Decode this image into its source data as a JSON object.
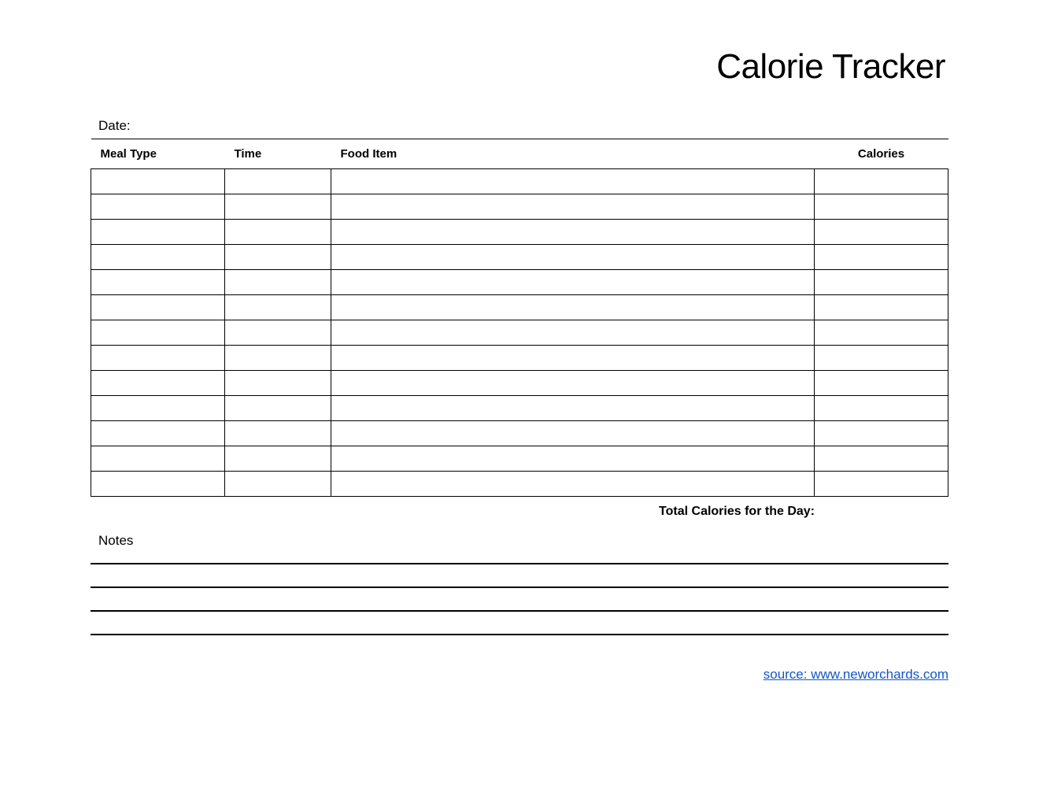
{
  "title": "Calorie Tracker",
  "date_label": "Date:",
  "headers": {
    "meal_type": "Meal Type",
    "time": "Time",
    "food_item": "Food Item",
    "calories": "Calories"
  },
  "rows": [
    {
      "meal_type": "",
      "time": "",
      "food_item": "",
      "calories": ""
    },
    {
      "meal_type": "",
      "time": "",
      "food_item": "",
      "calories": ""
    },
    {
      "meal_type": "",
      "time": "",
      "food_item": "",
      "calories": ""
    },
    {
      "meal_type": "",
      "time": "",
      "food_item": "",
      "calories": ""
    },
    {
      "meal_type": "",
      "time": "",
      "food_item": "",
      "calories": ""
    },
    {
      "meal_type": "",
      "time": "",
      "food_item": "",
      "calories": ""
    },
    {
      "meal_type": "",
      "time": "",
      "food_item": "",
      "calories": ""
    },
    {
      "meal_type": "",
      "time": "",
      "food_item": "",
      "calories": ""
    },
    {
      "meal_type": "",
      "time": "",
      "food_item": "",
      "calories": ""
    },
    {
      "meal_type": "",
      "time": "",
      "food_item": "",
      "calories": ""
    },
    {
      "meal_type": "",
      "time": "",
      "food_item": "",
      "calories": ""
    },
    {
      "meal_type": "",
      "time": "",
      "food_item": "",
      "calories": ""
    },
    {
      "meal_type": "",
      "time": "",
      "food_item": "",
      "calories": ""
    }
  ],
  "total_label": "Total Calories for the Day:",
  "total_value": "",
  "notes_label": "Notes",
  "note_lines": [
    "",
    "",
    "",
    ""
  ],
  "source_text": "source: www.neworchards.com",
  "source_href": "http://www.neworchards.com"
}
